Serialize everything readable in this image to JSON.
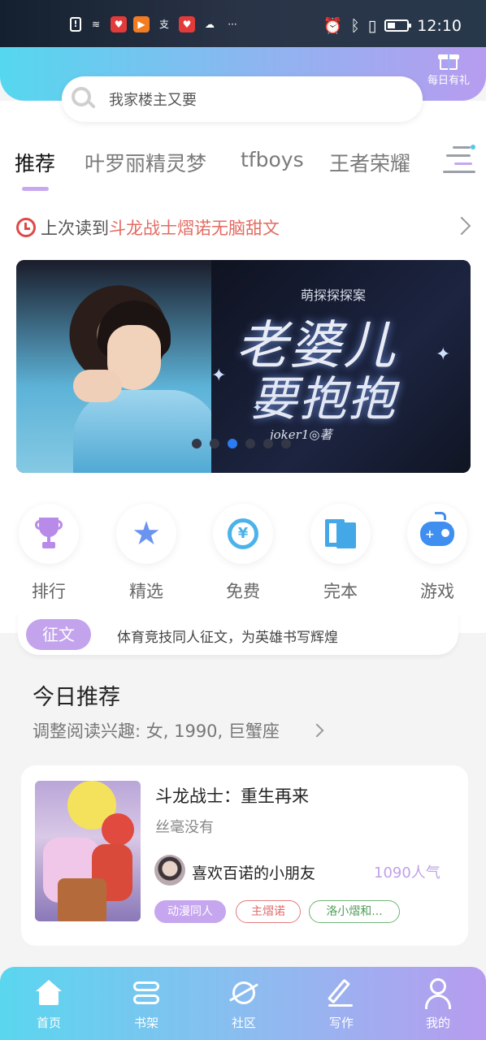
{
  "status_bar": {
    "time": "12:10",
    "left_icons": [
      "alert-icon",
      "wifi-icon",
      "app-red-icon",
      "app-orange-icon",
      "alipay-icon",
      "app-red-icon",
      "cloud-icon",
      "more-icon"
    ],
    "right_icons": [
      "alarm-icon",
      "bluetooth-icon",
      "vibrate-icon",
      "battery-icon"
    ],
    "more": "···"
  },
  "header": {
    "gift_label": "每日有礼",
    "search_placeholder": "我家楼主又要"
  },
  "tabs": [
    {
      "label": "推荐",
      "active": true
    },
    {
      "label": "叶罗丽精灵梦",
      "active": false
    },
    {
      "label": "tfboys",
      "active": false
    },
    {
      "label": "王者荣耀",
      "active": false
    }
  ],
  "last_read": {
    "prefix": "上次读到",
    "book": "斗龙战士熠诺无脑甜文"
  },
  "banner": {
    "series": "萌探探探案",
    "title_line1": "老婆儿",
    "title_line2": "要抱抱",
    "author": "joker1◎著",
    "slide_count": 6,
    "active_slide": 3
  },
  "quick_links": [
    {
      "label": "排行",
      "icon": "trophy-icon"
    },
    {
      "label": "精选",
      "icon": "star-icon"
    },
    {
      "label": "免费",
      "icon": "free-icon"
    },
    {
      "label": "完本",
      "icon": "book-icon"
    },
    {
      "label": "游戏",
      "icon": "gamepad-icon"
    }
  ],
  "contest": {
    "badge": "征文",
    "text": "体育竞技同人征文，为英雄书写辉煌"
  },
  "today": {
    "title": "今日推荐",
    "subtitle": "调整阅读兴趣: 女, 1990, 巨蟹座"
  },
  "book": {
    "title": "斗龙战士：重生再来",
    "description": "丝毫没有",
    "author": "喜欢百诺的小朋友",
    "popularity": "1090人气",
    "tags": [
      "动漫同人",
      "主熠诺",
      "洛小熠和..."
    ]
  },
  "bottom_nav": [
    {
      "label": "首页",
      "icon": "home-icon"
    },
    {
      "label": "书架",
      "icon": "bookshelf-icon"
    },
    {
      "label": "社区",
      "icon": "planet-icon"
    },
    {
      "label": "写作",
      "icon": "pen-icon"
    },
    {
      "label": "我的",
      "icon": "user-icon"
    }
  ],
  "colors": {
    "accent_purple": "#c3a4ec",
    "accent_red": "#e36b62",
    "active_dot": "#2b7bf2",
    "gradient_start": "#55d7ef",
    "gradient_end": "#b79cef"
  }
}
